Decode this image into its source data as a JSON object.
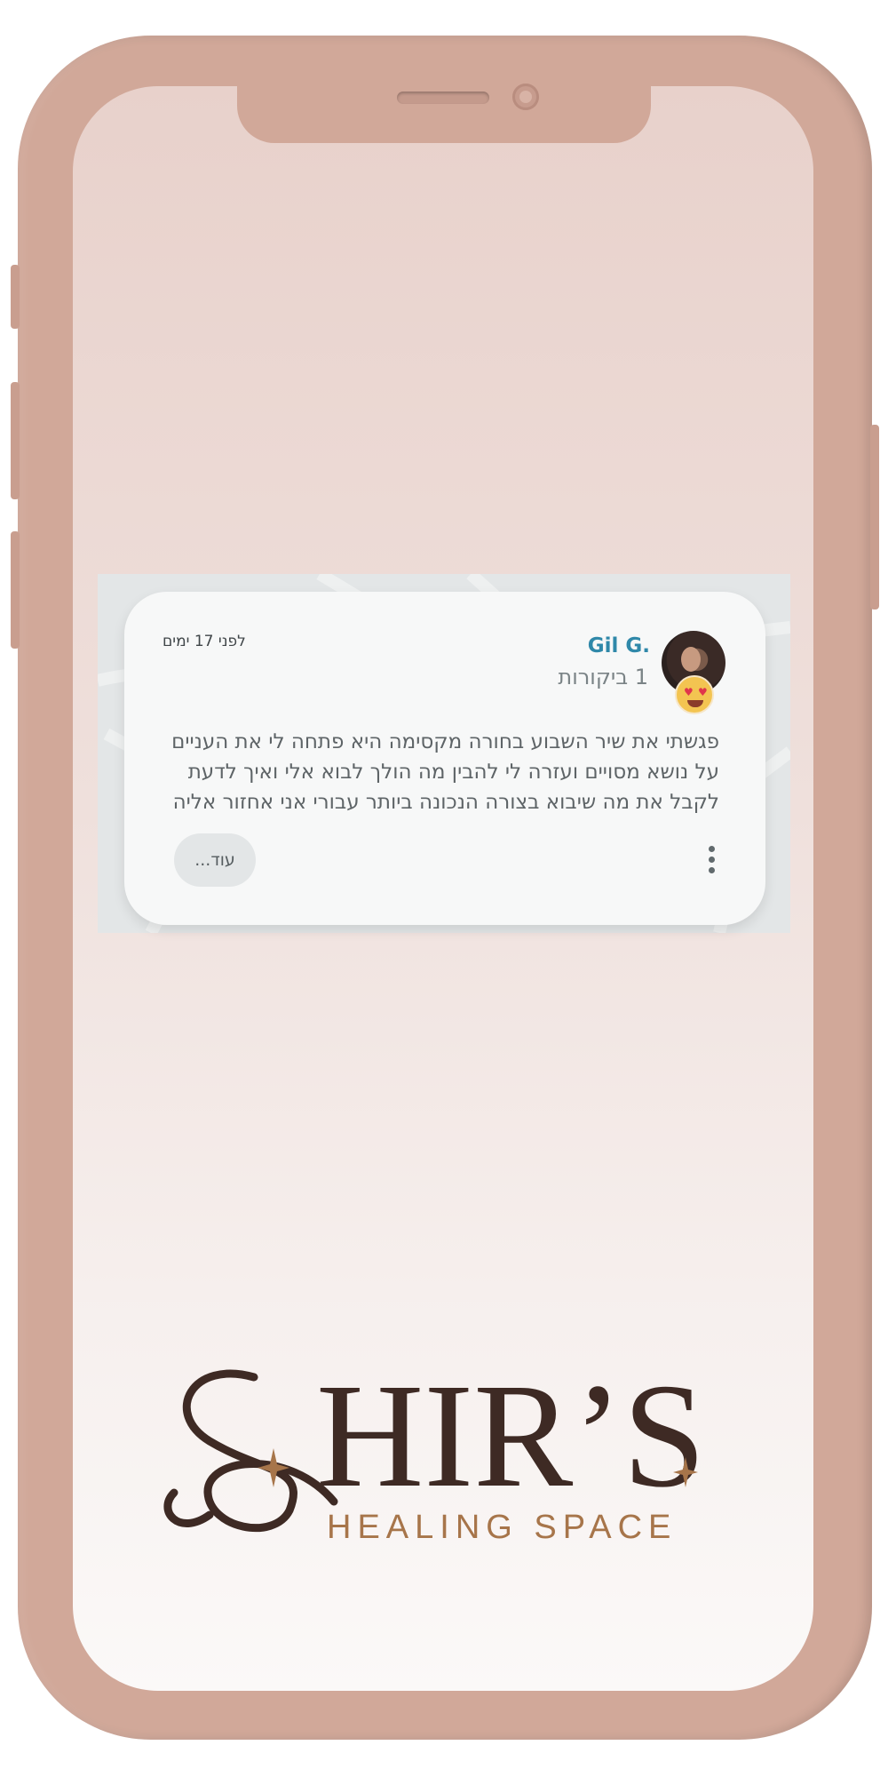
{
  "review": {
    "name": "Gil G.",
    "review_count": "1 ביקורות",
    "time_ago": "לפני 17 ימים",
    "text_lines": [
      "פגשתי את שיר השבוע בחורה מקסימה היא פתחה לי את העניים",
      "על נושא מסויים ועזרה לי להבין מה הולך לבוא אלי ואיך לדעת",
      "לקבל את מה שיבוא בצורה הנכונה ביותר עבורי אני אחזור אליה"
    ],
    "more_label": "עוד..."
  },
  "logo": {
    "wordmark": "SHIR'S",
    "tagline": "HEALING SPACE"
  },
  "colors": {
    "phone_frame": "#d1a899",
    "name_accent": "#2f88a9",
    "logo_dark": "#3e2a24",
    "logo_gold": "#a7754a"
  }
}
